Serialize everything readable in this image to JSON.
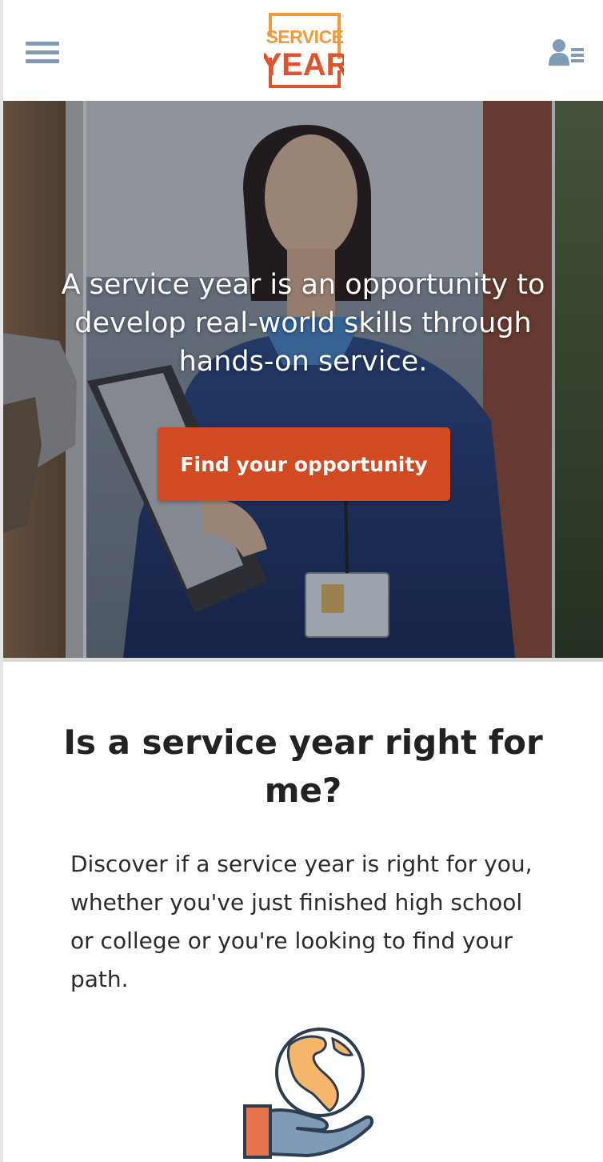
{
  "header": {
    "menu_icon": "hamburger-menu-icon",
    "logo": {
      "line1": "SERVICE",
      "line2": "YEAR",
      "color_top": "#f39a3c",
      "color_bottom": "#e0522b"
    },
    "user_icon": "user-list-icon",
    "icon_color": "#7f9bb7"
  },
  "hero": {
    "headline": "A service year is an opportunity to develop real-world skills through hands-on service.",
    "cta_label": "Find your opportunity",
    "cta_color": "#d24a24"
  },
  "section": {
    "title": "Is a service year right for me?",
    "body": "Discover if a service year is right for you, whether you've just finished high school or college or you're looking to find your path.",
    "illustration_icon": "globe-in-hand-icon"
  }
}
